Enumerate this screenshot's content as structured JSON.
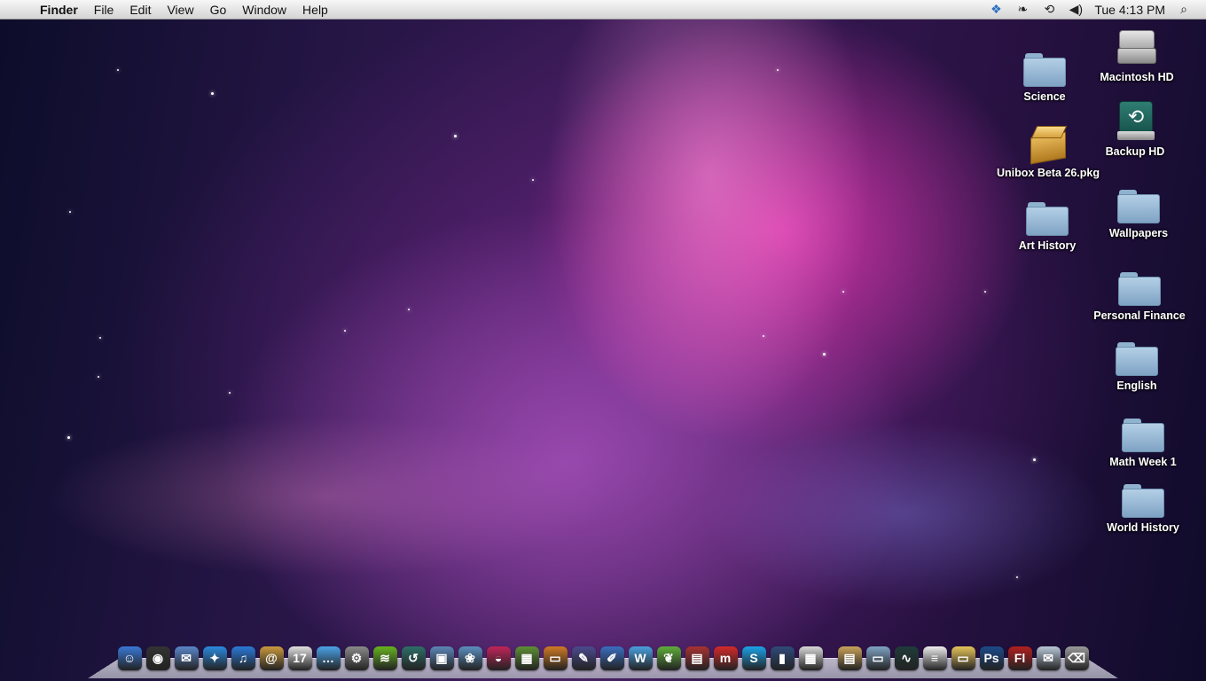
{
  "menubar": {
    "apple_symbol": "",
    "app_name": "Finder",
    "menus": [
      "File",
      "Edit",
      "View",
      "Go",
      "Window",
      "Help"
    ],
    "status_icons": [
      "dropbox-icon",
      "paw-icon",
      "time-machine-icon",
      "volume-icon"
    ],
    "clock": "Tue 4:13 PM",
    "search_icon": "spotlight-icon"
  },
  "desktop": {
    "icons": [
      {
        "label": "Macintosh HD",
        "type": "drive"
      },
      {
        "label": "Science",
        "type": "folder"
      },
      {
        "label": "Backup HD",
        "type": "time-machine-drive"
      },
      {
        "label": "Unibox Beta 26.pkg",
        "type": "package"
      },
      {
        "label": "Wallpapers",
        "type": "folder"
      },
      {
        "label": "Art History",
        "type": "folder"
      },
      {
        "label": "Personal Finance",
        "type": "folder"
      },
      {
        "label": "English",
        "type": "folder"
      },
      {
        "label": "Math Week 1",
        "type": "folder"
      },
      {
        "label": "World History",
        "type": "folder"
      }
    ]
  },
  "dock": {
    "apps": [
      {
        "name": "finder-icon",
        "glyph": "☺",
        "color": "#3a78d6"
      },
      {
        "name": "dashboard-icon",
        "glyph": "◉",
        "color": "#333333"
      },
      {
        "name": "mail-icon",
        "glyph": "✉",
        "color": "#5a86c9"
      },
      {
        "name": "safari-icon",
        "glyph": "✦",
        "color": "#2b8ae0"
      },
      {
        "name": "itunes-icon",
        "glyph": "♫",
        "color": "#2a79d8"
      },
      {
        "name": "address-book-icon",
        "glyph": "@",
        "color": "#c9993e"
      },
      {
        "name": "ical-icon",
        "glyph": "17",
        "color": "#e0e0e0"
      },
      {
        "name": "messages-icon",
        "glyph": "…",
        "color": "#4aa3e8"
      },
      {
        "name": "system-preferences-icon",
        "glyph": "⚙",
        "color": "#8a8a8a"
      },
      {
        "name": "spotify-icon",
        "glyph": "≋",
        "color": "#67b31f"
      },
      {
        "name": "time-machine-icon",
        "glyph": "↺",
        "color": "#2e6e67"
      },
      {
        "name": "preview-icon",
        "glyph": "▣",
        "color": "#5c86b8"
      },
      {
        "name": "iphoto-icon",
        "glyph": "❀",
        "color": "#5b8fbf"
      },
      {
        "name": "photo-booth-icon",
        "glyph": "◒",
        "color": "#c0245a"
      },
      {
        "name": "minecraft-icon",
        "glyph": "▦",
        "color": "#5e8f35"
      },
      {
        "name": "keynote-icon",
        "glyph": "▭",
        "color": "#d07a24"
      },
      {
        "name": "xcode-icon",
        "glyph": "✎",
        "color": "#4b4b8f"
      },
      {
        "name": "ilife-icon",
        "glyph": "✐",
        "color": "#3a6ec0"
      },
      {
        "name": "wunderlist-icon",
        "glyph": "W",
        "color": "#4aa0e0"
      },
      {
        "name": "growl-icon",
        "glyph": "❦",
        "color": "#5fae3a"
      },
      {
        "name": "photo-browser-icon",
        "glyph": "▤",
        "color": "#a83232"
      },
      {
        "name": "mendeley-icon",
        "glyph": "m",
        "color": "#d42a2a"
      },
      {
        "name": "skype-icon",
        "glyph": "S",
        "color": "#1aa3e8"
      },
      {
        "name": "dictionary-icon",
        "glyph": "▮",
        "color": "#2f4a7a"
      },
      {
        "name": "calculator-icon",
        "glyph": "▦",
        "color": "#d8d8d8"
      }
    ],
    "folders": [
      {
        "name": "documents-stack-icon",
        "glyph": "▤",
        "color": "#c9a25a"
      },
      {
        "name": "applications-folder-icon",
        "glyph": "▭",
        "color": "#7fa3c4"
      },
      {
        "name": "activity-monitor-icon",
        "glyph": "∿",
        "color": "#1f3b3a"
      },
      {
        "name": "text-file-icon",
        "glyph": "≡",
        "color": "#eeeeee"
      },
      {
        "name": "downloads-folder-icon",
        "glyph": "▭",
        "color": "#e6c45a"
      },
      {
        "name": "photoshop-icon",
        "glyph": "Ps",
        "color": "#1c4a8a"
      },
      {
        "name": "flash-icon",
        "glyph": "Fl",
        "color": "#b11f1f"
      },
      {
        "name": "mail-stack-icon",
        "glyph": "✉",
        "color": "#b8c7d8"
      },
      {
        "name": "trash-icon",
        "glyph": "⌫",
        "color": "#9a9a9a"
      }
    ]
  }
}
